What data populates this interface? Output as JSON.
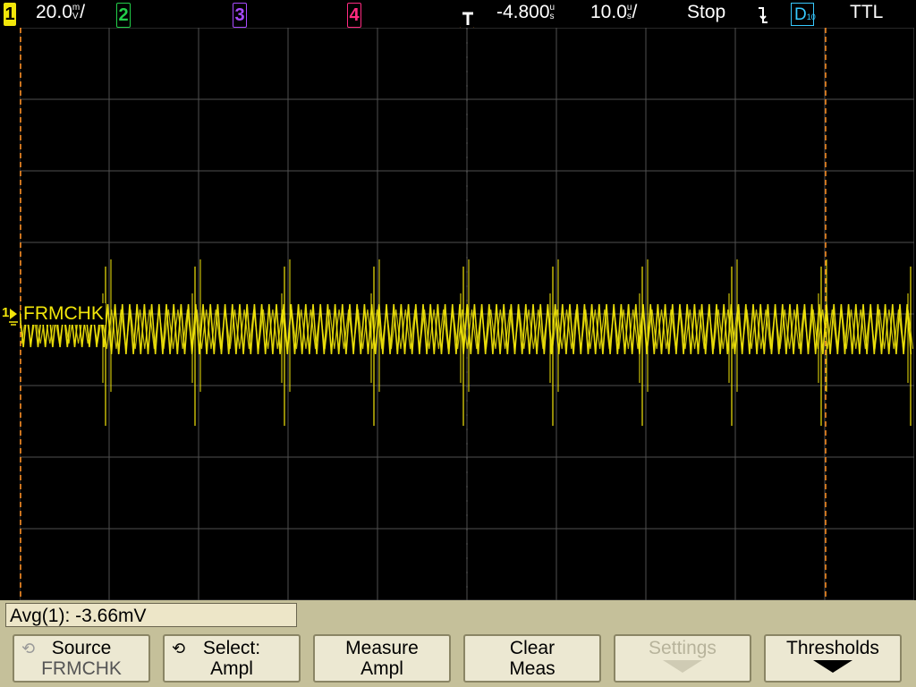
{
  "header": {
    "ch1": "1",
    "ch1_scale": "20.0",
    "ch1_unit_top": "m",
    "ch1_unit_bot": "V",
    "ch2": "2",
    "ch3": "3",
    "ch4": "4",
    "delay": "-4.800",
    "delay_unit_top": "u",
    "delay_unit_bot": "s",
    "timebase": "10.0",
    "timebase_unit_top": "u",
    "timebase_unit_bot": "s",
    "run_state": "Stop",
    "digital_badge": "D",
    "digital_sub": "10",
    "threshold_label": "TTL"
  },
  "channel_label": "FRMCHK",
  "marker_1": "1",
  "measurement": "Avg(1): -3.66mV",
  "softkeys": [
    {
      "line1": "Source",
      "line2": "FRMCHK"
    },
    {
      "line1": "Select:",
      "line2": "Ampl"
    },
    {
      "line1": "Measure",
      "line2": "Ampl"
    },
    {
      "line1": "Clear",
      "line2": "Meas"
    },
    {
      "line1": "Settings"
    },
    {
      "line1": "Thresholds"
    }
  ],
  "colors": {
    "ch1": "#f2e60a",
    "ch2": "#22d04a",
    "ch3": "#a84bff",
    "ch4": "#ff2a80",
    "digital": "#37c9ff",
    "trigger": "#ff8c1a",
    "grid": "#505050"
  }
}
